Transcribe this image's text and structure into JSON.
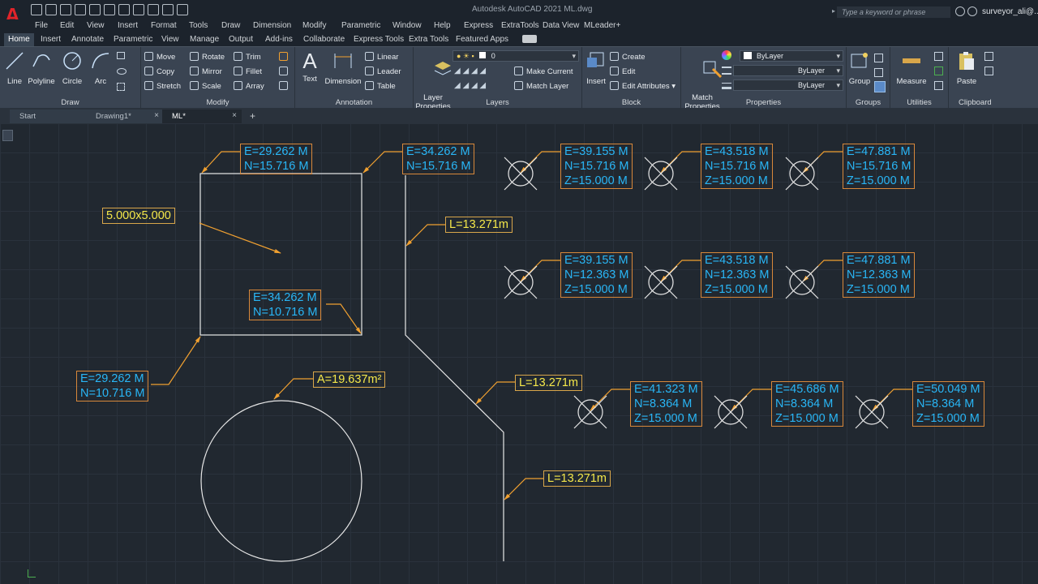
{
  "titlebar": {
    "title": "Autodesk AutoCAD 2021    ML.dwg",
    "search_placeholder": "Type a keyword or phrase",
    "user": "surveyor_ali@..."
  },
  "menu": [
    "File",
    "Edit",
    "View",
    "Insert",
    "Format",
    "Tools",
    "Draw",
    "Dimension",
    "Modify",
    "Parametric",
    "Window",
    "Help",
    "Express",
    "ExtraTools",
    "Data View",
    "MLeader+"
  ],
  "ribbon_tabs": [
    "Home",
    "Insert",
    "Annotate",
    "Parametric",
    "View",
    "Manage",
    "Output",
    "Add-ins",
    "Collaborate",
    "Express Tools",
    "Extra Tools",
    "Featured Apps"
  ],
  "ribbon": {
    "draw": {
      "title": "Draw",
      "line": "Line",
      "polyline": "Polyline",
      "circle": "Circle",
      "arc": "Arc"
    },
    "modify": {
      "title": "Modify",
      "move": "Move",
      "rotate": "Rotate",
      "trim": "Trim",
      "copy": "Copy",
      "mirror": "Mirror",
      "fillet": "Fillet",
      "stretch": "Stretch",
      "scale": "Scale",
      "array": "Array"
    },
    "annotation": {
      "title": "Annotation",
      "text": "Text",
      "dimension": "Dimension",
      "linear": "Linear",
      "leader": "Leader",
      "table": "Table"
    },
    "layers": {
      "title": "Layers",
      "layer_properties": "Layer\nProperties",
      "current_layer": "0",
      "make_current": "Make Current",
      "match_layer": "Match Layer"
    },
    "block": {
      "title": "Block",
      "insert": "Insert",
      "create": "Create",
      "edit": "Edit",
      "edit_attributes": "Edit Attributes"
    },
    "properties": {
      "title": "Properties",
      "match_properties": "Match\nProperties",
      "color": "ByLayer",
      "linetype": "ByLayer",
      "lineweight": "ByLayer"
    },
    "groups": {
      "title": "Groups",
      "group": "Group"
    },
    "utilities": {
      "title": "Utilities",
      "measure": "Measure"
    },
    "clipboard": {
      "title": "Clipboard",
      "paste": "Paste"
    }
  },
  "doc_tabs": [
    "Start",
    "Drawing1*",
    "ML*"
  ],
  "drawing": {
    "square_size": "5.000x5.000",
    "square_top_left": "E=29.262 M\nN=15.716 M",
    "square_top_right": "E=34.262 M\nN=15.716 M",
    "square_bottom_right": "E=34.262 M\nN=10.716 M",
    "square_bottom_left": "E=29.262 M\nN=10.716 M",
    "circle_area": "A=19.637m²",
    "polyline_length_1": "L=13.271m",
    "polyline_length_2": "L=13.271m",
    "polyline_length_3": "L=13.271m",
    "points": [
      "E=39.155 M\nN=15.716 M\nZ=15.000 M",
      "E=43.518 M\nN=15.716 M\nZ=15.000 M",
      "E=47.881 M\nN=15.716 M\nZ=15.000 M",
      "E=39.155 M\nN=12.363 M\nZ=15.000 M",
      "E=43.518 M\nN=12.363 M\nZ=15.000 M",
      "E=47.881 M\nN=12.363 M\nZ=15.000 M",
      "E=41.323 M\nN=8.364 M\nZ=15.000 M",
      "E=45.686 M\nN=8.364 M\nZ=15.000 M",
      "E=50.049 M\nN=8.364 M\nZ=15.000 M"
    ]
  },
  "colors": {
    "label_text": "#29b6f6",
    "label_border": "#d8883a",
    "dimension_text": "#f5e84a",
    "leader": "#f0a030",
    "geometry": "#e8e8e8"
  }
}
